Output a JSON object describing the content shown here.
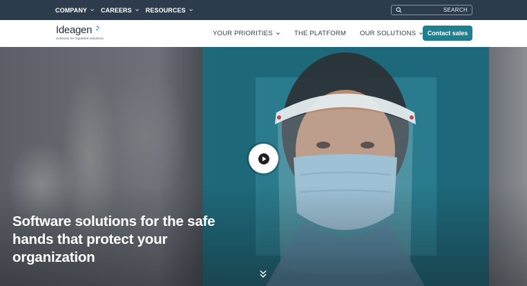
{
  "topbar": {
    "nav": [
      {
        "label": "COMPANY",
        "icon": "chevron-down-icon"
      },
      {
        "label": "CAREERS",
        "icon": "chevron-down-icon"
      },
      {
        "label": "RESOURCES",
        "icon": "chevron-down-icon"
      }
    ],
    "search": {
      "label": "SEARCH",
      "icon": "search-icon"
    }
  },
  "header": {
    "logo": {
      "brand": "Ideagen",
      "tagline": "Solutions for regulated industries"
    },
    "nav": [
      {
        "label": "YOUR PRIORITIES",
        "icon": "chevron-down-icon"
      },
      {
        "label": "THE PLATFORM"
      },
      {
        "label": "OUR SOLUTIONS",
        "icon": "chevron-down-icon"
      }
    ],
    "cta": "Contact sales"
  },
  "hero": {
    "headline_lines": [
      "Software solutions for the safe",
      "hands that protect your",
      "organization"
    ],
    "play_icon": "play-icon",
    "scroll_icon": "chevron-double-down-icon"
  },
  "colors": {
    "topbar": "#2d3c4c",
    "accent": "#1f7f8f",
    "teal_panel": "#1b6a7c"
  }
}
